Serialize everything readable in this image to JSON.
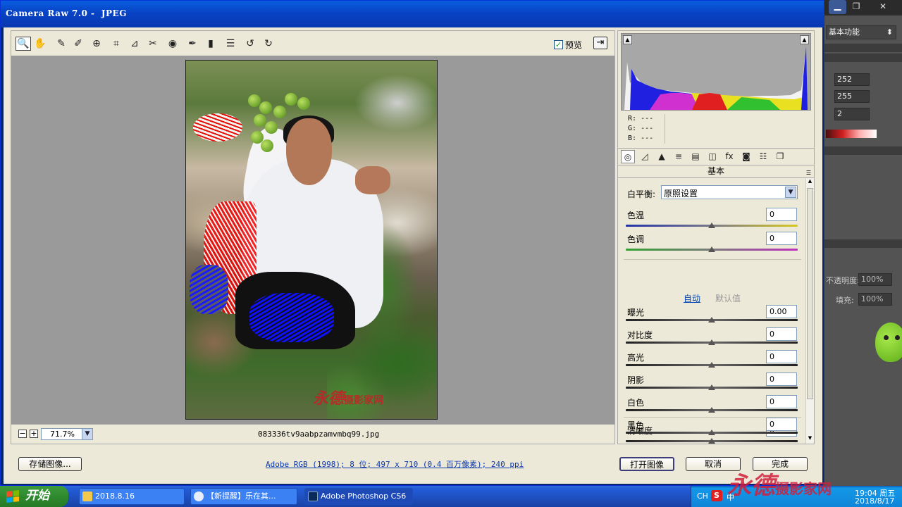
{
  "window": {
    "title": "Camera Raw 7.0 -  JPEG",
    "controls": [
      "minimize",
      "maximize",
      "close"
    ]
  },
  "toolbar": {
    "tools": [
      {
        "name": "zoom-tool",
        "icon": "magnifier-icon",
        "glyph": "🔍",
        "active": true
      },
      {
        "name": "hand-tool",
        "icon": "hand-icon",
        "glyph": "✋"
      },
      {
        "name": "white-balance-tool",
        "icon": "eyedropper-icon",
        "glyph": "✎"
      },
      {
        "name": "color-sampler-tool",
        "icon": "sampler-icon",
        "glyph": "✐"
      },
      {
        "name": "targeted-adjustment-tool",
        "icon": "target-icon",
        "glyph": "⊕"
      },
      {
        "name": "crop-tool",
        "icon": "crop-icon",
        "glyph": "⌗"
      },
      {
        "name": "straighten-tool",
        "icon": "straighten-icon",
        "glyph": "⊿"
      },
      {
        "name": "spot-removal-tool",
        "icon": "spot-removal-icon",
        "glyph": "✂"
      },
      {
        "name": "red-eye-tool",
        "icon": "red-eye-icon",
        "glyph": "◉"
      },
      {
        "name": "adjustment-brush-tool",
        "icon": "brush-icon",
        "glyph": "✒"
      },
      {
        "name": "graduated-filter-tool",
        "icon": "graduated-filter-icon",
        "glyph": "▮"
      },
      {
        "name": "preferences-tool",
        "icon": "list-icon",
        "glyph": "☰"
      },
      {
        "name": "rotate-left-tool",
        "icon": "rotate-left-icon",
        "glyph": "↺"
      },
      {
        "name": "rotate-right-tool",
        "icon": "rotate-right-icon",
        "glyph": "↻"
      }
    ],
    "preview_label": "预览",
    "preview_checked": true
  },
  "canvas": {
    "zoom_value": "71.7%",
    "filename": "083336tv9aabpzamvmbq99.jpg",
    "watermark_text": "永德",
    "watermark_sub": "摄影家网"
  },
  "histogram": {
    "r_label": "R:",
    "g_label": "G:",
    "b_label": "B:",
    "r_value": "---",
    "g_value": "---",
    "b_value": "---"
  },
  "panel_tabs": [
    {
      "name": "tab-basic",
      "icon": "aperture-icon",
      "glyph": "◎",
      "active": true
    },
    {
      "name": "tab-tone-curve",
      "icon": "curve-icon",
      "glyph": "◿"
    },
    {
      "name": "tab-detail",
      "icon": "detail-icon",
      "glyph": "▲"
    },
    {
      "name": "tab-hsl",
      "icon": "hsl-icon",
      "glyph": "≡"
    },
    {
      "name": "tab-split-toning",
      "icon": "split-toning-icon",
      "glyph": "▤"
    },
    {
      "name": "tab-lens-corrections",
      "icon": "lens-icon",
      "glyph": "◫"
    },
    {
      "name": "tab-effects",
      "icon": "fx-icon",
      "glyph": "fx"
    },
    {
      "name": "tab-camera-calibration",
      "icon": "camera-icon",
      "glyph": "◙"
    },
    {
      "name": "tab-presets",
      "icon": "presets-icon",
      "glyph": "☷"
    },
    {
      "name": "tab-snapshots",
      "icon": "snapshots-icon",
      "glyph": "❐"
    }
  ],
  "basic_panel": {
    "title": "基本",
    "white_balance_label": "白平衡:",
    "white_balance_value": "原照设置",
    "temp_label": "色温",
    "temp_value": "0",
    "tint_label": "色调",
    "tint_value": "0",
    "auto_label": "自动",
    "default_label": "默认值",
    "sliders": [
      {
        "label": "曝光",
        "value": "0.00"
      },
      {
        "label": "对比度",
        "value": "0"
      },
      {
        "label": "高光",
        "value": "0"
      },
      {
        "label": "阴影",
        "value": "0"
      },
      {
        "label": "白色",
        "value": "0"
      },
      {
        "label": "黑色",
        "value": "0"
      }
    ],
    "clarity_label": "清晰度",
    "clarity_value": "0"
  },
  "bottom": {
    "save_label": "存储图像...",
    "info_link": "Adobe RGB (1998); 8 位; 497 x 710 (0.4 百万像素); 240 ppi",
    "open_label": "打开图像",
    "cancel_label": "取消",
    "done_label": "完成"
  },
  "photoshop": {
    "workspace": "基本功能",
    "values": [
      "252",
      "255",
      "2"
    ],
    "opacity_label": "不透明度:",
    "opacity_value": "100%",
    "fill_label": "填充:",
    "fill_value": "100%"
  },
  "taskbar": {
    "start_label": "开始",
    "tasks": [
      {
        "name": "task-folder",
        "label": "2018.8.16",
        "color": "#f2c94c"
      },
      {
        "name": "task-browser",
        "label": "【新提醒】乐在其...",
        "color": "#e8eef8"
      },
      {
        "name": "task-photoshop",
        "label": "Adobe Photoshop CS6",
        "color": "#0b2a5c"
      }
    ],
    "lang": "CH",
    "ime": "中",
    "time": "19:04",
    "weekday": "周五",
    "date": "2018/8/17",
    "watermark_text": "永德",
    "watermark_sub": "摄影家网"
  },
  "colors": {
    "accent": "#0a5de0",
    "panel_bg": "#ece9d8",
    "clip_highlight": "#f20000",
    "clip_shadow": "#1010ff"
  }
}
